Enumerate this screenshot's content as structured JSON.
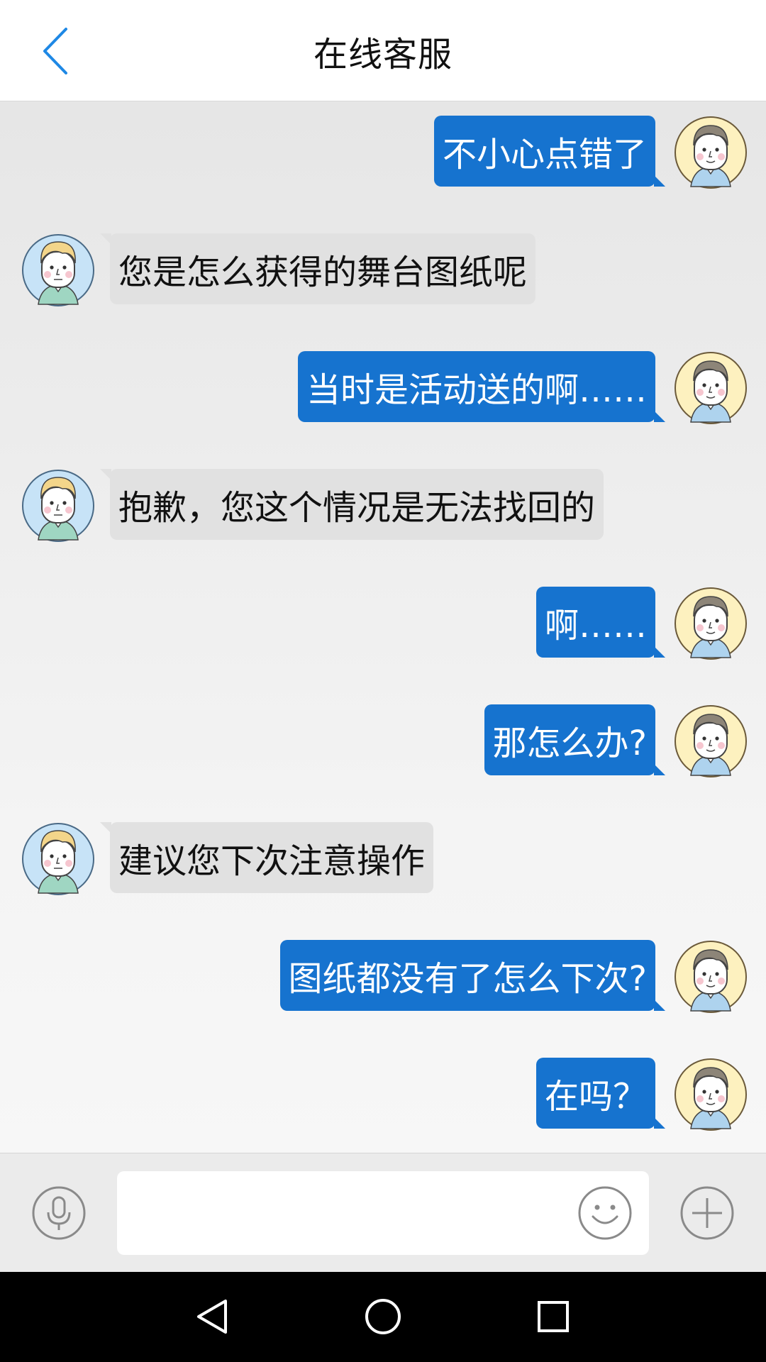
{
  "header": {
    "title": "在线客服",
    "back_icon": "chevron-left-icon"
  },
  "colors": {
    "accent": "#1e88e5",
    "sent_bubble": "#1673cf",
    "received_bubble": "#e1e1e1"
  },
  "messages": [
    {
      "direction": "out",
      "text": "不小心点错了"
    },
    {
      "direction": "in",
      "text": "您是怎么获得的舞台图纸呢"
    },
    {
      "direction": "out",
      "text": "当时是活动送的啊……"
    },
    {
      "direction": "in",
      "text": "抱歉，您这个情况是无法找回的"
    },
    {
      "direction": "out",
      "text": "啊……"
    },
    {
      "direction": "out",
      "text": "那怎么办?"
    },
    {
      "direction": "in",
      "text": "建议您下次注意操作"
    },
    {
      "direction": "out",
      "text": "图纸都没有了怎么下次?"
    },
    {
      "direction": "out",
      "text": "在吗？"
    }
  ],
  "input_bar": {
    "voice_icon": "microphone-icon",
    "emoji_icon": "smiley-icon",
    "add_icon": "plus-circle-icon",
    "placeholder": ""
  },
  "navbar": {
    "back_icon": "triangle-back-icon",
    "home_icon": "circle-home-icon",
    "recents_icon": "square-recents-icon"
  }
}
